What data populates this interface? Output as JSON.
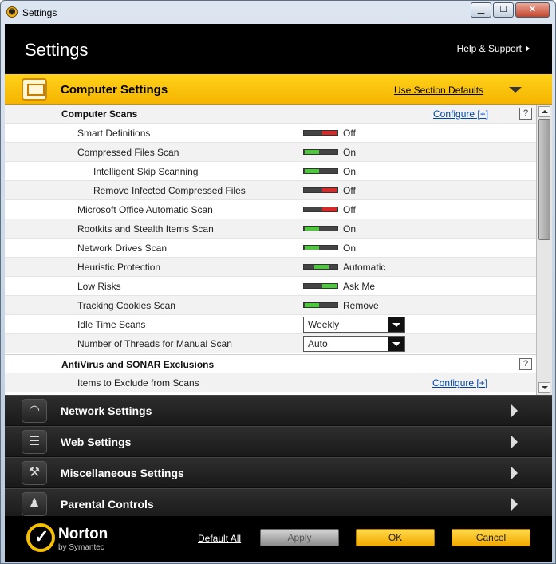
{
  "window": {
    "title": "Settings",
    "min": "▁",
    "max": "☐",
    "close": "✕"
  },
  "header": {
    "title": "Settings",
    "help": "Help & Support"
  },
  "section": {
    "title": "Computer Settings",
    "defaults_link": "Use Section Defaults"
  },
  "groups": {
    "computer_scans": {
      "label": "Computer Scans",
      "configure": "Configure [+]",
      "help": "?"
    },
    "antivirus": {
      "label": "AntiVirus and SONAR Exclusions",
      "help": "?"
    },
    "exclude": {
      "label": "Items to Exclude from Scans",
      "configure": "Configure [+]"
    }
  },
  "settings": [
    {
      "label": "Smart Definitions",
      "state": "Off"
    },
    {
      "label": "Compressed Files Scan",
      "state": "On"
    },
    {
      "label": "Intelligent Skip Scanning",
      "state": "On"
    },
    {
      "label": "Remove Infected Compressed Files",
      "state": "Off"
    },
    {
      "label": "Microsoft Office Automatic Scan",
      "state": "Off"
    },
    {
      "label": "Rootkits and Stealth Items Scan",
      "state": "On"
    },
    {
      "label": "Network Drives Scan",
      "state": "On"
    },
    {
      "label": "Heuristic Protection",
      "state": "Automatic"
    },
    {
      "label": "Low Risks",
      "state": "Ask Me"
    },
    {
      "label": "Tracking Cookies Scan",
      "state": "Remove"
    },
    {
      "label": "Idle Time Scans",
      "value": "Weekly"
    },
    {
      "label": "Number of Threads for Manual Scan",
      "value": "Auto"
    }
  ],
  "categories": [
    {
      "label": "Network Settings",
      "icon": "wifi-icon"
    },
    {
      "label": "Web Settings",
      "icon": "web-icon"
    },
    {
      "label": "Miscellaneous Settings",
      "icon": "wrench-icon"
    },
    {
      "label": "Parental Controls",
      "icon": "family-icon"
    }
  ],
  "footer": {
    "brand": "Norton",
    "by": "by Symantec",
    "default_all": "Default All",
    "apply": "Apply",
    "ok": "OK",
    "cancel": "Cancel"
  },
  "colors": {
    "accent": "#f5b400",
    "on": "#4cc93b",
    "off": "#d42a2a"
  }
}
